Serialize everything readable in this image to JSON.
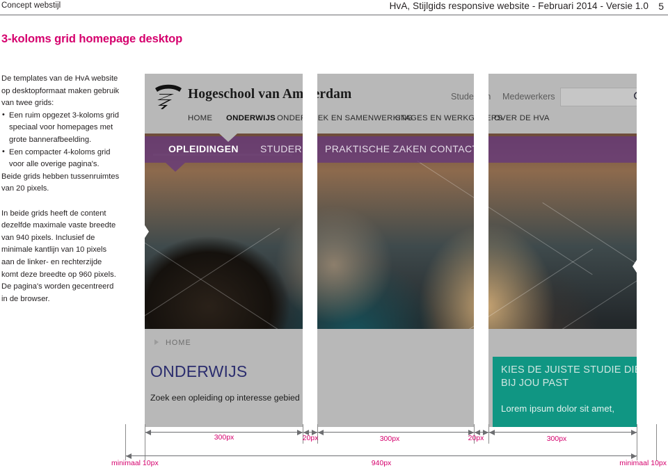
{
  "page_header": {
    "left_label": "Concept webstijl",
    "right_label": "HvA, Stijlgids responsive website - Februari 2014 - Versie 1.0",
    "page_number": "5"
  },
  "section": {
    "title": "3-koloms grid homepage desktop"
  },
  "left_column": {
    "intro": "De templates van de HvA website op desktopformaat maken gebruik van twee grids:",
    "bullets": [
      "Een ruim opgezet 3-koloms grid speciaal voor homepages met grote bannerafbeelding.",
      "Een compacter 4-koloms grid voor alle overige pagina's."
    ],
    "after_bullets": "Beide grids hebben tussenruimtes van 20 pixels.",
    "paragraph_2": "In beide grids heeft de content dezelfde maximale vaste breedte van 940 pixels. Inclusief de minimale kantlijn van 10 pixels aan de linker- en rechterzijde komt deze breedte op 960 pixels.",
    "paragraph_3": "De pagina's worden gecentreerd in de browser."
  },
  "mockup": {
    "brand": "Hogeschool van Amsterdam",
    "top_links": [
      "Studenten",
      "Medewerkers"
    ],
    "search_placeholder": "",
    "search_icon": "search-icon",
    "main_nav": [
      {
        "label": "HOME",
        "active": false
      },
      {
        "label": "ONDERWIJS",
        "active": true
      },
      {
        "label": "ONDERZOEK EN SAMENWERKING",
        "active": false
      },
      {
        "label": "STAGES EN WERKGEVERS",
        "active": false
      },
      {
        "label": "OVER DE HVA",
        "active": false
      }
    ],
    "sub_nav": [
      {
        "label": "OPLEIDINGEN",
        "active": true
      },
      {
        "label": "STUDEREN",
        "active": false
      },
      {
        "label": "PRAKTISCHE ZAKEN",
        "active": false
      },
      {
        "label": "CONTACT",
        "active": false
      }
    ],
    "breadcrumb": "HOME",
    "page_heading": "ONDERWIJS",
    "search_prompt": "Zoek een opleiding op interesse gebied",
    "promo": {
      "title": "KIES DE JUISTE STUDIE DIE BIJ JOU PAST",
      "body": "Lorem ipsum dolor sit amet,"
    }
  },
  "dimensions": {
    "columns": [
      "300px",
      "20px",
      "300px",
      "20px",
      "300px"
    ],
    "total": "940px",
    "margin_left": "minimaal 10px",
    "margin_right": "minimaal 10px"
  },
  "colors": {
    "accent_pink": "#d5006d",
    "purple_nav": "#67397a",
    "teal_promo": "#109683",
    "grey_band": "#b8b8b8",
    "heading_blue": "#2b2d6e"
  }
}
